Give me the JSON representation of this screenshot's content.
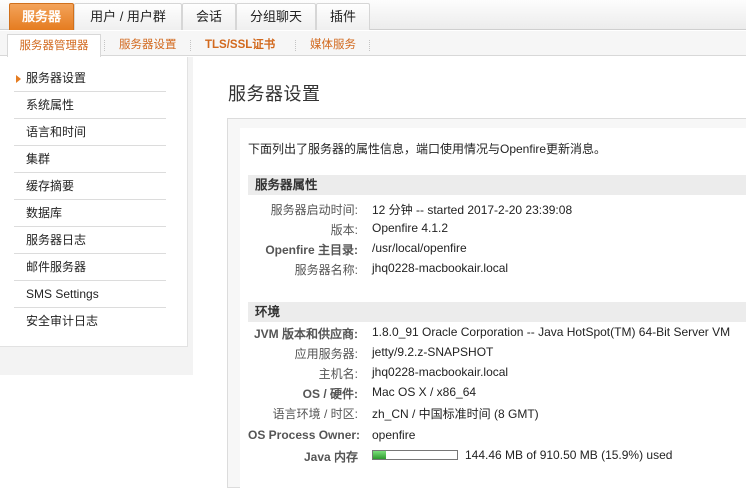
{
  "topnav": {
    "tabs": [
      {
        "label": "服务器",
        "active": true
      },
      {
        "label": "用户 / 用户群",
        "active": false
      },
      {
        "label": "会话",
        "active": false
      },
      {
        "label": "分组聊天",
        "active": false
      },
      {
        "label": "插件",
        "active": false
      }
    ]
  },
  "subnav": {
    "items": [
      {
        "label": "服务器管理器",
        "active": true
      },
      {
        "label": "服务器设置",
        "active": false
      },
      {
        "label": "TLS/SSL证书",
        "active": false
      },
      {
        "label": "媒体服务",
        "active": false
      }
    ]
  },
  "sidebar": {
    "items": [
      {
        "label": "服务器设置",
        "active": true
      },
      {
        "label": "系统属性",
        "active": false
      },
      {
        "label": "语言和时间",
        "active": false
      },
      {
        "label": "集群",
        "active": false
      },
      {
        "label": "缓存摘要",
        "active": false
      },
      {
        "label": "数据库",
        "active": false
      },
      {
        "label": "服务器日志",
        "active": false
      },
      {
        "label": "邮件服务器",
        "active": false
      },
      {
        "label": "SMS Settings",
        "active": false
      },
      {
        "label": "安全审计日志",
        "active": false
      }
    ]
  },
  "main": {
    "title": "服务器设置",
    "intro": "下面列出了服务器的属性信息，端口使用情况与Openfire更新消息。",
    "server_props": {
      "heading": "服务器属性",
      "rows": [
        {
          "label": "服务器启动时间:",
          "value": "12 分钟 -- started 2017-2-20 23:39:08"
        },
        {
          "label": "版本:",
          "value": "Openfire 4.1.2"
        },
        {
          "label": "Openfire 主目录:",
          "value": "/usr/local/openfire"
        },
        {
          "label": "服务器名称:",
          "value": "jhq0228-macbookair.local"
        }
      ]
    },
    "environment": {
      "heading": "环境",
      "rows": [
        {
          "label": "JVM 版本和供应商:",
          "value": "1.8.0_91 Oracle Corporation -- Java HotSpot(TM) 64-Bit Server VM"
        },
        {
          "label": "应用服务器:",
          "value": "jetty/9.2.z-SNAPSHOT"
        },
        {
          "label": "主机名:",
          "value": "jhq0228-macbookair.local"
        },
        {
          "label": "OS / 硬件:",
          "value": "Mac OS X / x86_64"
        },
        {
          "label": "语言环境 / 时区:",
          "value": "zh_CN / 中国标准时间 (8 GMT)"
        },
        {
          "label": "OS Process Owner:",
          "value": "openfire"
        }
      ],
      "memory": {
        "label": "Java 内存",
        "value": "144.46 MB of 910.50 MB (15.9%) used",
        "fraction": 0.159
      }
    }
  }
}
